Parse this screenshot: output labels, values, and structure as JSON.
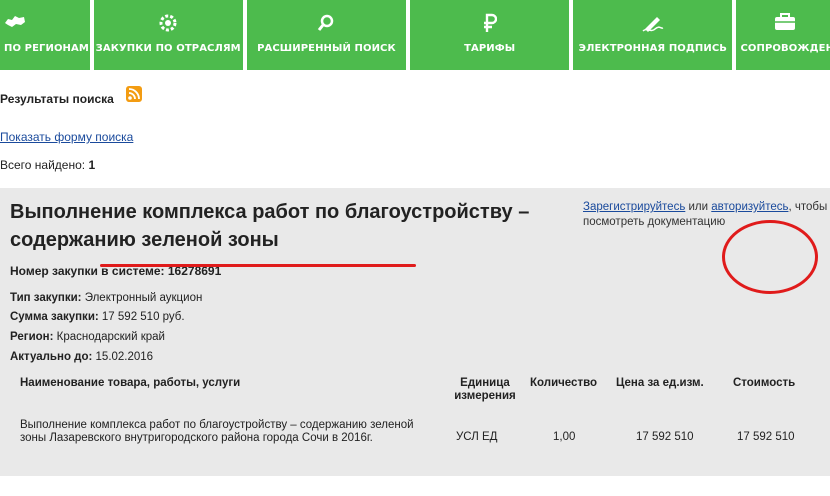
{
  "nav": [
    {
      "label": "ПО РЕГИОНАМ",
      "icon": "russia-map-icon"
    },
    {
      "label": "ЗАКУПКИ ПО ОТРАСЛЯМ",
      "icon": "gear-icon"
    },
    {
      "label": "РАСШИРЕННЫЙ ПОИСК",
      "icon": "search-icon"
    },
    {
      "label": "ТАРИФЫ",
      "icon": "ruble-icon"
    },
    {
      "label": "ЭЛЕКТРОННАЯ ПОДПИСЬ",
      "icon": "signature-icon"
    },
    {
      "label": "СОПРОВОЖДЕНИЕ ТЕ",
      "icon": "briefcase-icon"
    }
  ],
  "results": {
    "title": "Результаты поиска",
    "show_form": "Показать форму поиска",
    "found_label": "Всего найдено: ",
    "found_count": "1"
  },
  "card": {
    "title": "Выполнение комплекса работ по благоустройству – содержанию зеленой зоны",
    "auth_register": "Зарегистрируйтесь",
    "auth_or": " или ",
    "auth_login": "авторизуйтесь",
    "auth_rest": ", чтобы посмотреть документацию",
    "reg_no": "Номер закупки в системе: 16278691",
    "type_label": "Тип закупки:",
    "type_value": " Электронный аукцион",
    "sum_label": "Сумма закупки:",
    "sum_value": " 17 592 510 руб.",
    "region_label": "Регион:",
    "region_value": " Краснодарский край",
    "actual_label": "Актуально до:",
    "actual_value": " 15.02.2016"
  },
  "table": {
    "headers": [
      "Наименование товара, работы, услуги",
      "Единица измерения",
      "Количество",
      "Цена за ед.изм.",
      "Стоимость"
    ],
    "row": {
      "name": "Выполнение комплекса работ по благоустройству – содержанию зеленой зоны Лазаревского внутригородского района города Сочи в 2016г.",
      "unit": "УСЛ ЕД",
      "qty": "1,00",
      "price": "17 592 510",
      "cost": "17 592 510"
    }
  }
}
